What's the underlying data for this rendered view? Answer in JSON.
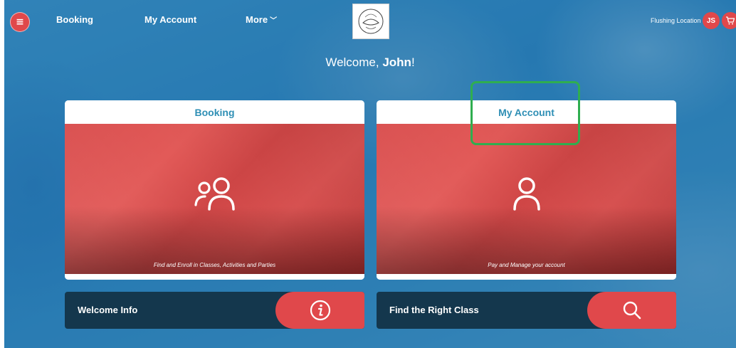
{
  "header": {
    "menu_icon": "hamburger-icon",
    "nav": [
      {
        "label": "Booking"
      },
      {
        "label": "My Account"
      },
      {
        "label": "More"
      }
    ],
    "location": "Flushing Location",
    "user_initials": "JS",
    "cart_icon": "cart-icon"
  },
  "welcome": {
    "prefix": "Welcome, ",
    "name": "John",
    "suffix": "!"
  },
  "cards": [
    {
      "title": "Booking",
      "icon": "users-icon",
      "caption": "Find and Enroll in Classes, Activities and Parties"
    },
    {
      "title": "My Account",
      "icon": "user-icon",
      "caption": "Pay and Manage your account"
    }
  ],
  "bars": [
    {
      "label": "Welcome Info",
      "icon": "info-icon"
    },
    {
      "label": "Find the Right Class",
      "icon": "search-icon"
    }
  ],
  "colors": {
    "accent_red": "#e0484b",
    "title_blue": "#2f8fb5",
    "bar_navy": "#14374d",
    "highlight_green": "#2fae4f"
  }
}
